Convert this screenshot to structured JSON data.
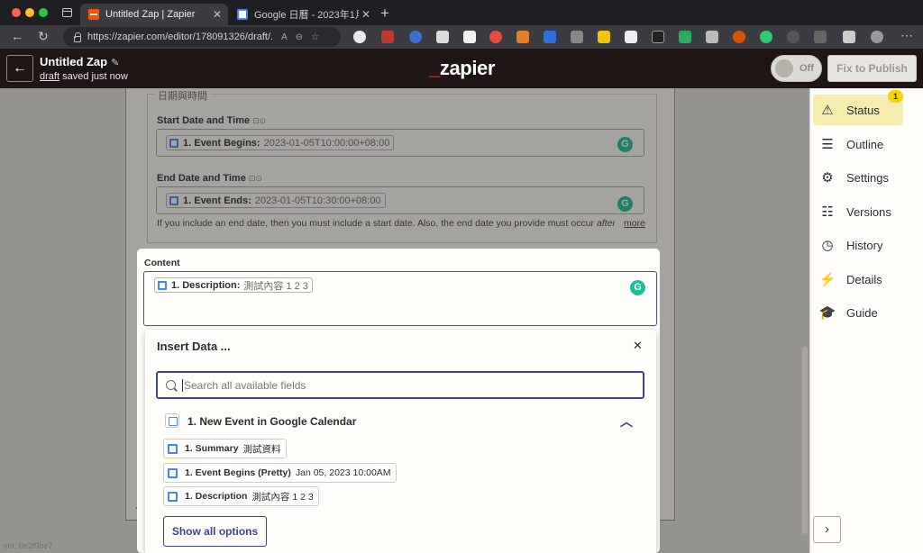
{
  "browser": {
    "tabs": [
      {
        "title": "Untitled Zap | Zapier",
        "close": "✕"
      },
      {
        "title": "Google 日曆 - 2023年1月",
        "close": "✕"
      }
    ],
    "new_tab": "+",
    "url": "https://zapier.com/editor/178091326/draft/..."
  },
  "header": {
    "zap_title": "Untitled Zap",
    "draft_link": "draft",
    "saved_status": "saved just now",
    "logo": "zapier",
    "toggle_label": "Off",
    "publish_label": "Fix to Publish"
  },
  "form": {
    "fieldset_legend": "日期與時間",
    "start": {
      "label": "Start Date and Time",
      "pill_name": "1. Event Begins:",
      "pill_value": "2023-01-05T10:00:00+08:00"
    },
    "end": {
      "label": "End Date and Time",
      "pill_name": "1. Event Ends:",
      "pill_value": "2023-01-05T10:30:00+08:00"
    },
    "hint": "If you include an end date, then you must include a start date. Also, the end date you provide must occur",
    "hint_after": "after...",
    "more": "more",
    "content_label": "Content",
    "content_pill_name": "1. Description:",
    "content_pill_value": "測試內容 1 2 3"
  },
  "insert_modal": {
    "title": "Insert Data ...",
    "close": "✕",
    "search_placeholder": "Search all available fields",
    "group_title": "1. New Event in Google Calendar",
    "options": [
      {
        "name": "1. Summary",
        "value": "測試資料"
      },
      {
        "name": "1. Event Begins (Pretty)",
        "value": "Jan 05, 2023 10:00AM"
      },
      {
        "name": "1. Description",
        "value": "測試內容 1 2 3"
      }
    ],
    "show_all": "Show all options"
  },
  "sidebar": {
    "status_badge": "1",
    "items": [
      {
        "label": "Status",
        "icon": "warning-icon"
      },
      {
        "label": "Outline",
        "icon": "list-icon"
      },
      {
        "label": "Settings",
        "icon": "gear-icon"
      },
      {
        "label": "Versions",
        "icon": "stack-icon"
      },
      {
        "label": "History",
        "icon": "clock-icon"
      },
      {
        "label": "Details",
        "icon": "bolt-file-icon"
      },
      {
        "label": "Guide",
        "icon": "graduation-cap-icon"
      }
    ]
  },
  "version": "ver. 0e2f9be7",
  "colors": {
    "brand_orange": "#ff4f00",
    "header_bg": "#201515",
    "accent_blue": "#3d4592",
    "status_active_bg": "#f5ecae",
    "grammarly_green": "#15c39a"
  }
}
